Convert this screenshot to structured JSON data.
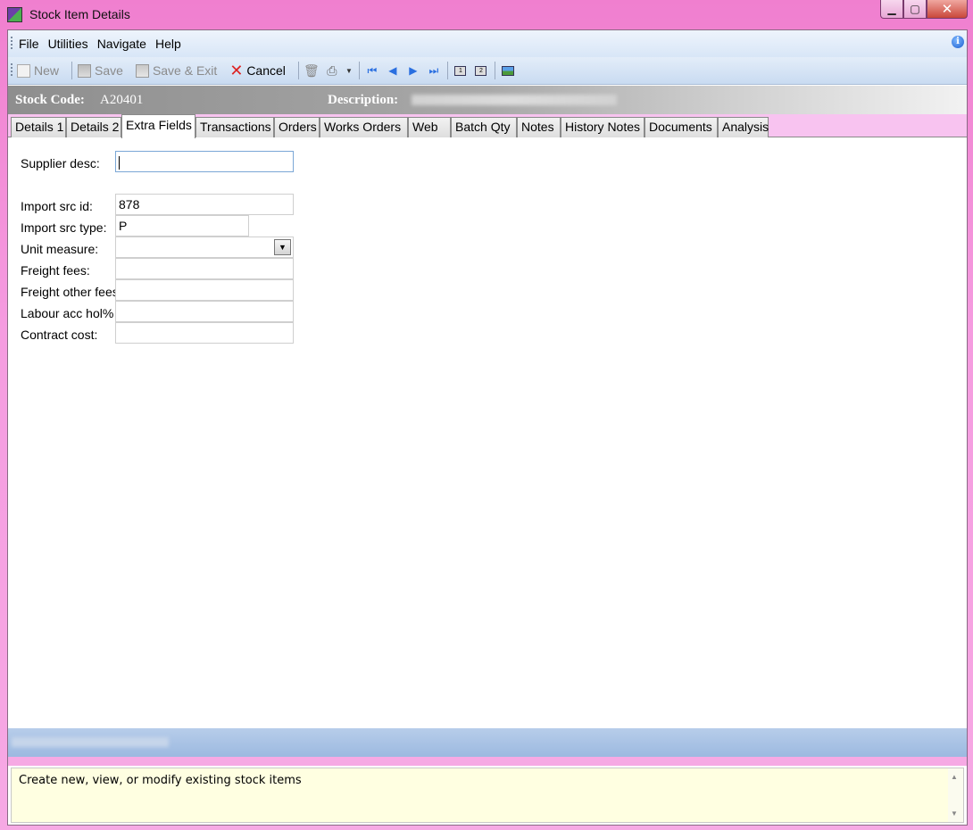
{
  "window": {
    "title": "Stock Item Details"
  },
  "menu": [
    "File",
    "Utilities",
    "Navigate",
    "Help"
  ],
  "toolbar": {
    "new_label": "New",
    "save_label": "Save",
    "save_exit_label": "Save & Exit",
    "cancel_label": "Cancel"
  },
  "header": {
    "stock_code_label": "Stock Code:",
    "stock_code_value": "A20401",
    "description_label": "Description:"
  },
  "tabs": [
    "Details 1",
    "Details 2",
    "Extra Fields",
    "Transactions",
    "Orders",
    "Works Orders",
    "Web",
    "Batch Qty",
    "Notes",
    "History Notes",
    "Documents",
    "Analysis"
  ],
  "active_tab": "Extra Fields",
  "fields": {
    "supplier_desc": {
      "label": "Supplier desc:",
      "value": ""
    },
    "import_src_id": {
      "label": "Import src id:",
      "value": "878"
    },
    "import_src_type": {
      "label": "Import src type:",
      "value": "P"
    },
    "unit_measure": {
      "label": "Unit measure:",
      "value": ""
    },
    "freight_fees": {
      "label": "Freight fees:",
      "value": ""
    },
    "freight_other_fees": {
      "label": "Freight other fees",
      "value": ""
    },
    "labour_acc_hol": {
      "label": "Labour acc hol%",
      "value": ""
    },
    "contract_cost": {
      "label": "Contract cost:",
      "value": ""
    }
  },
  "help": {
    "text": "Create new, view, or modify existing stock items"
  }
}
